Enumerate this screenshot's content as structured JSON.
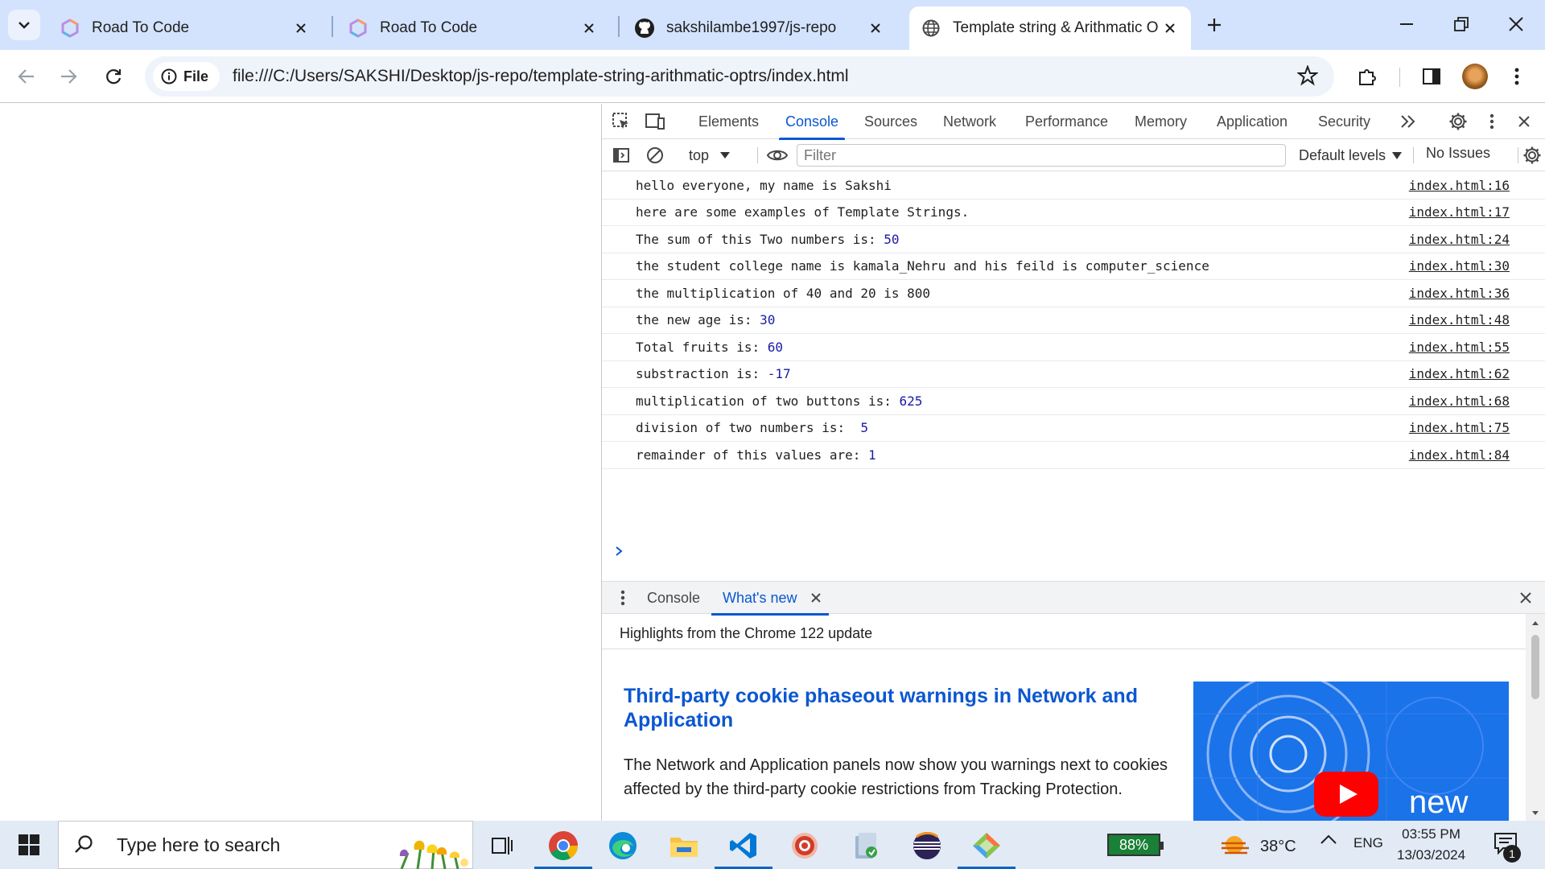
{
  "browser": {
    "tabs": [
      {
        "title": "Road To Code",
        "active": false
      },
      {
        "title": "Road To Code",
        "active": false
      },
      {
        "title": "sakshilambe1997/js-repo",
        "active": false
      },
      {
        "title": "Template string & Arithmatic O",
        "active": true
      }
    ],
    "omnibox": {
      "chip_label": "File",
      "url": "file:///C:/Users/SAKSHI/Desktop/js-repo/template-string-arithmatic-optrs/index.html"
    }
  },
  "devtools": {
    "tabs": [
      "Elements",
      "Console",
      "Sources",
      "Network",
      "Performance",
      "Memory",
      "Application",
      "Security"
    ],
    "active_tab": "Console",
    "console_toolbar": {
      "context": "top",
      "filter_placeholder": "Filter",
      "levels": "Default levels",
      "issues": "No Issues"
    },
    "logs": [
      {
        "text": "hello everyone, my name is Sakshi",
        "num": "",
        "source": "index.html:16"
      },
      {
        "text": "here are some examples of Template Strings.",
        "num": "",
        "source": "index.html:17"
      },
      {
        "text": "The sum of this Two numbers is: ",
        "num": "50",
        "source": "index.html:24"
      },
      {
        "text": "the student college name is kamala_Nehru and his feild is computer_science",
        "num": "",
        "source": "index.html:30"
      },
      {
        "text": "the multiplication of 40 and 20 is 800",
        "num": "",
        "source": "index.html:36"
      },
      {
        "text": "the new age is: ",
        "num": "30",
        "source": "index.html:48"
      },
      {
        "text": "Total fruits is: ",
        "num": "60",
        "source": "index.html:55"
      },
      {
        "text": "substraction is: ",
        "num": "-17",
        "source": "index.html:62"
      },
      {
        "text": "multiplication of two buttons is: ",
        "num": "625",
        "source": "index.html:68"
      },
      {
        "text": "division of two numbers is:  ",
        "num": "5",
        "source": "index.html:75"
      },
      {
        "text": "remainder of this values are: ",
        "num": "1",
        "source": "index.html:84"
      }
    ],
    "drawer": {
      "tabs": [
        "Console",
        "What's new"
      ],
      "active_tab": "What's new",
      "highlights": "Highlights from the Chrome 122 update",
      "article_title": "Third-party cookie phaseout warnings in Network and Application",
      "article_body": "The Network and Application panels now show you warnings next to cookies affected by the third-party cookie restrictions from Tracking Protection.",
      "image_label": "new"
    }
  },
  "taskbar": {
    "search_placeholder": "Type here to search",
    "battery": "88%",
    "temperature": "38°C",
    "language": "ENG",
    "time": "03:55 PM",
    "date": "13/03/2024",
    "notifications": "1"
  }
}
